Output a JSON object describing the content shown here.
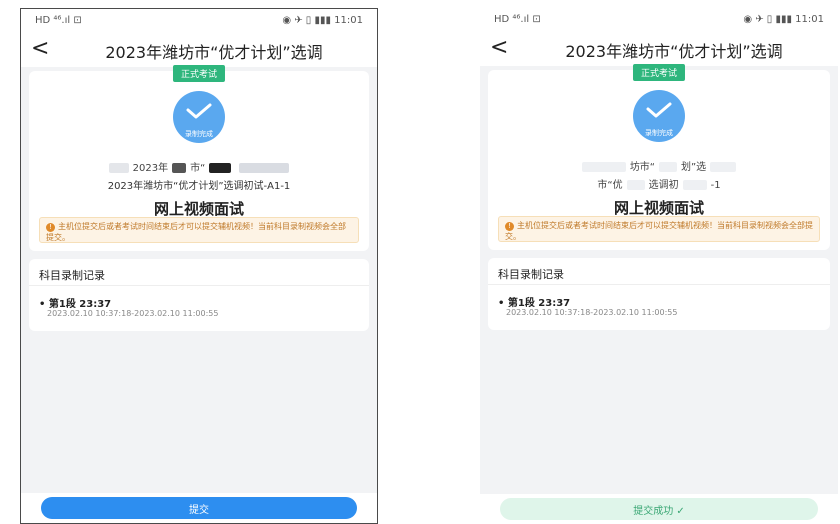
{
  "screens": [
    {
      "status": {
        "left": "HD ⁴⁶.ıl ⊡",
        "right": "◉ ✈ ▯ ▮▮▮ 11:01"
      },
      "nav": {
        "back": "<",
        "title": "2023年潍坊市“优才计划”选调"
      },
      "exam": {
        "tag": "正式考试",
        "done_label": "录制完成",
        "line1_parts": [
          "2023年",
          "市“"
        ],
        "line2": "2023年潍坊市“优才计划”选调初试-A1-1",
        "interview_title": "网上视频面试",
        "notice": "主机位提交后或者考试时间结束后才可以提交辅机视频！当前科目录制视频会全部提交。"
      },
      "record": {
        "title": "科目录制记录",
        "segment": "• 第1段  23:37",
        "time_range": "2023.02.10 10:37:18-2023.02.10 11:00:55"
      },
      "submit_label": "提交"
    },
    {
      "status": {
        "left": "HD ⁴⁶.ıl ⊡",
        "right": "◉ ✈ ▯ ▮▮▮ 11:01"
      },
      "nav": {
        "back": "<",
        "title": "2023年潍坊市“优才计划”选调"
      },
      "exam": {
        "tag": "正式考试",
        "done_label": "录制完成",
        "line1_parts": [
          "坊市“",
          "划”选"
        ],
        "line2_parts": [
          "市“优",
          "选调初",
          "-1"
        ],
        "interview_title": "网上视频面试",
        "notice": "主机位提交后或者考试时间结束后才可以提交辅机视频！当前科目录制视频会全部提交。"
      },
      "record": {
        "title": "科目录制记录",
        "segment": "• 第1段  23:37",
        "time_range": "2023.02.10 10:37:18-2023.02.10 11:00:55"
      },
      "submit_label": "提交成功 ✓"
    }
  ],
  "colors": {
    "accent": "#2d8ef0",
    "success": "#2eb67d",
    "warning": "#e08a2a",
    "blur": "#d9dce2"
  }
}
